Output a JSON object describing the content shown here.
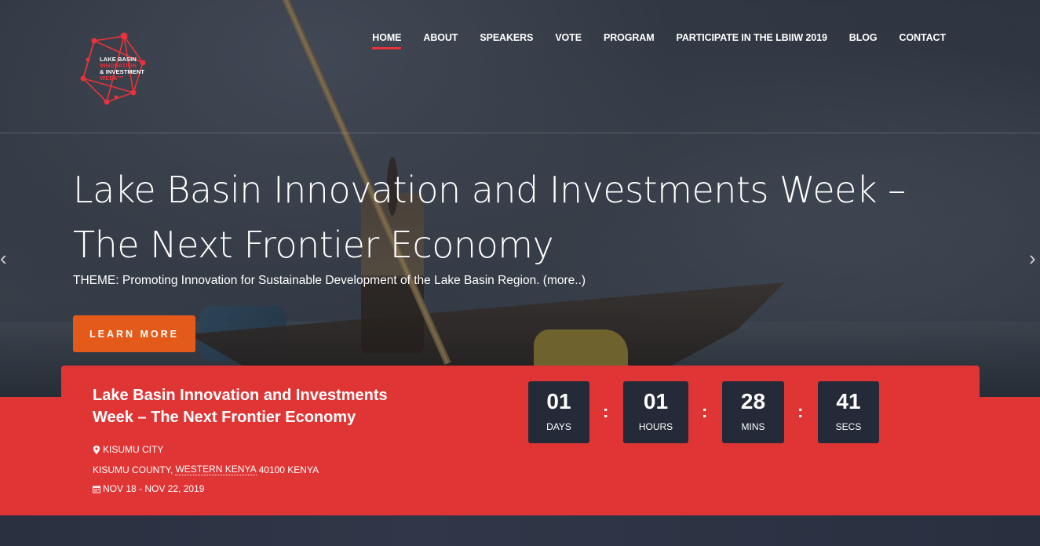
{
  "logo": {
    "line1": "LAKE BASIN",
    "line2": "INNOVATION",
    "line3": "& INVESTMENT",
    "line4": "WEEK™"
  },
  "nav": {
    "items": [
      {
        "label": "HOME",
        "active": true
      },
      {
        "label": "ABOUT"
      },
      {
        "label": "SPEAKERS"
      },
      {
        "label": "VOTE"
      },
      {
        "label": "PROGRAM"
      },
      {
        "label": "PARTICIPATE IN THE LBIIW 2019"
      },
      {
        "label": "BLOG"
      },
      {
        "label": "CONTACT"
      }
    ]
  },
  "slide": {
    "title": "Lake Basin Innovation and Investments Week – The Next Frontier Economy",
    "theme": "THEME: Promoting Innovation for Sustainable Development of the Lake Basin Region. (more..)",
    "button": "LEARN MORE"
  },
  "event": {
    "title": "Lake Basin Innovation and Investments Week – The Next Frontier Economy",
    "location": "KISUMU CITY",
    "address_county": "KISUMU COUNTY,",
    "address_region": "WESTERN KENYA",
    "address_rest": "40100 KENYA",
    "dates": "NOV 18 - NOV 22, 2019"
  },
  "countdown": {
    "days": {
      "value": "01",
      "label": "DAYS"
    },
    "hours": {
      "value": "01",
      "label": "HOURS"
    },
    "mins": {
      "value": "28",
      "label": "MINS"
    },
    "secs": {
      "value": "41",
      "label": "SECS"
    },
    "separator": ":"
  },
  "colors": {
    "accent": "#e03535",
    "button": "#e35a1a",
    "countdown_box": "#252a38"
  }
}
